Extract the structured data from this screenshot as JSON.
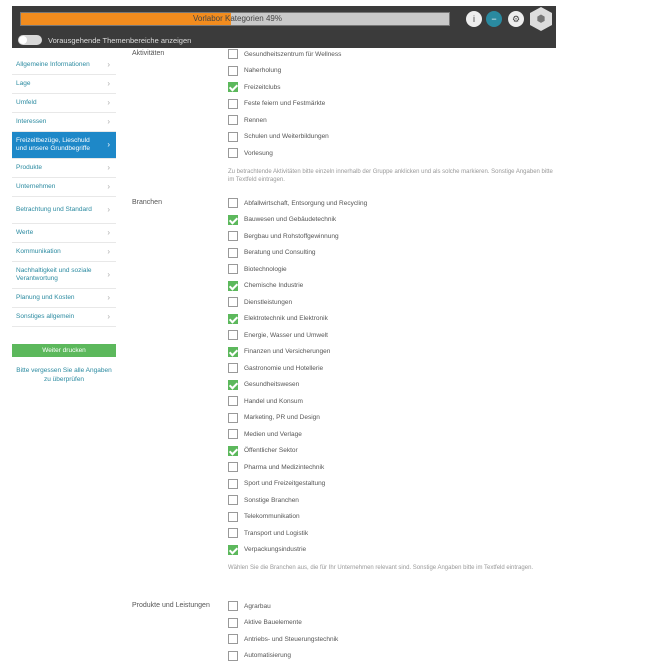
{
  "header": {
    "progress_text": "Vorlabor Kategorien 49%",
    "progress_value": 0.49,
    "accent_color": "#f28c1e",
    "toggle_label": "Vorausgehende Themenbereiche anzeigen",
    "buttons": [
      {
        "icon": "info-icon",
        "glyph": "i"
      },
      {
        "icon": "minus-icon",
        "glyph": "−"
      },
      {
        "icon": "gear-icon",
        "glyph": "⚙"
      },
      {
        "icon": "hexagon-icon",
        "glyph": "⬢"
      }
    ]
  },
  "sidebar": {
    "items": [
      {
        "label": "Allgemeine Informationen",
        "active": false,
        "tall": false
      },
      {
        "label": "Lage",
        "active": false,
        "tall": false
      },
      {
        "label": "Umfeld",
        "active": false,
        "tall": false
      },
      {
        "label": "Interessen",
        "active": false,
        "tall": false
      },
      {
        "label": "Freizeitbezüge, Lieschuld und unsere Grundbegriffe",
        "active": true,
        "tall": true
      },
      {
        "label": "Produkte",
        "active": false,
        "tall": false
      },
      {
        "label": "Unternehmen",
        "active": false,
        "tall": false
      },
      {
        "label": "Betrachtung und Standard",
        "active": false,
        "tall": true
      },
      {
        "label": "Werte",
        "active": false,
        "tall": false
      },
      {
        "label": "Kommunikation",
        "active": false,
        "tall": false
      },
      {
        "label": "Nachhaltigkeit und soziale Verantwortung",
        "active": false,
        "tall": true
      },
      {
        "label": "Planung und Kosten",
        "active": false,
        "tall": false
      },
      {
        "label": "Sonstiges allgemein",
        "active": false,
        "tall": false
      }
    ],
    "button_label": "Weiter drucken",
    "note": "Bitte vergessen Sie alle Angaben zu überprüfen"
  },
  "sections": [
    {
      "label": "Aktivitäten",
      "items": [
        {
          "label": "Gesundheitszentrum für Wellness",
          "checked": false
        },
        {
          "label": "Naherholung",
          "checked": false
        },
        {
          "label": "Freizeitclubs",
          "checked": true
        },
        {
          "label": "Feste feiern und Festmärkte",
          "checked": false
        },
        {
          "label": "Rennen",
          "checked": false
        },
        {
          "label": "Schulen und Weiterbildungen",
          "checked": false
        },
        {
          "label": "Vorlesung",
          "checked": false
        }
      ],
      "note": "Zu betrachtende Aktivitäten bitte einzeln innerhalb der Gruppe anklicken und als solche markieren. Sonstige Angaben bitte im Textfeld eintragen."
    },
    {
      "label": "Branchen",
      "items": [
        {
          "label": "Abfallwirtschaft, Entsorgung und Recycling",
          "checked": false
        },
        {
          "label": "Bauwesen und Gebäudetechnik",
          "checked": true
        },
        {
          "label": "Bergbau und Rohstoffgewinnung",
          "checked": false
        },
        {
          "label": "Beratung und Consulting",
          "checked": false
        },
        {
          "label": "Biotechnologie",
          "checked": false
        },
        {
          "label": "Chemische Industrie",
          "checked": true
        },
        {
          "label": "Dienstleistungen",
          "checked": false
        },
        {
          "label": "Elektrotechnik und Elektronik",
          "checked": true
        },
        {
          "label": "Energie, Wasser und Umwelt",
          "checked": false
        },
        {
          "label": "Finanzen und Versicherungen",
          "checked": true
        },
        {
          "label": "Gastronomie und Hotellerie",
          "checked": false
        },
        {
          "label": "Gesundheitswesen",
          "checked": true
        },
        {
          "label": "Handel und Konsum",
          "checked": false
        },
        {
          "label": "Marketing, PR und Design",
          "checked": false
        },
        {
          "label": "Medien und Verlage",
          "checked": false
        },
        {
          "label": "Öffentlicher Sektor",
          "checked": true
        },
        {
          "label": "Pharma und Medizintechnik",
          "checked": false
        },
        {
          "label": "Sport und Freizeitgestaltung",
          "checked": false
        },
        {
          "label": "Sonstige Branchen",
          "checked": false
        },
        {
          "label": "Telekommunikation",
          "checked": false
        },
        {
          "label": "Transport und Logistik",
          "checked": false
        },
        {
          "label": "Verpackungsindustrie",
          "checked": true
        }
      ],
      "note": "Wählen Sie die Branchen aus, die für Ihr Unternehmen relevant sind. Sonstige Angaben bitte im Textfeld eintragen."
    },
    {
      "label": "Produkte und Leistungen",
      "items": [
        {
          "label": "Agrarbau",
          "checked": false
        },
        {
          "label": "Aktive Bauelemente",
          "checked": false
        },
        {
          "label": "Antriebs- und Steuerungstechnik",
          "checked": false
        },
        {
          "label": "Automatisierung",
          "checked": false
        }
      ]
    }
  ]
}
